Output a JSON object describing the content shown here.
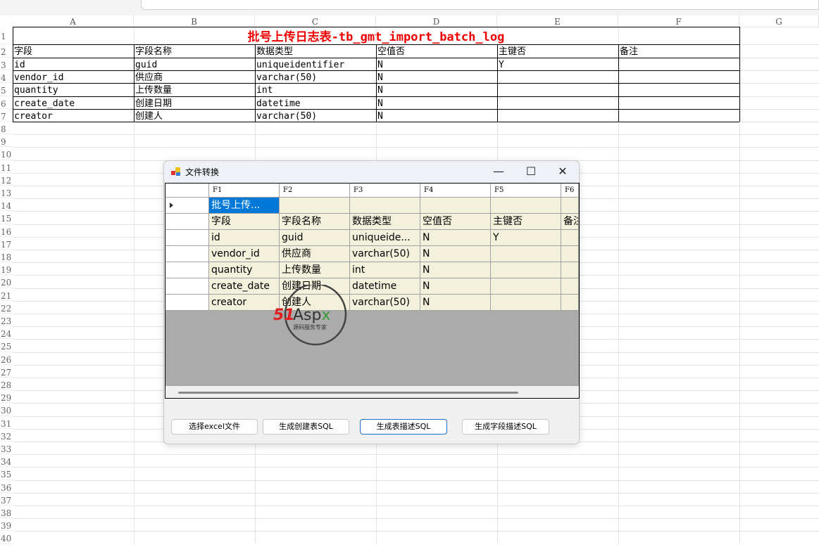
{
  "sheet": {
    "columns": [
      "A",
      "B",
      "C",
      "D",
      "E",
      "F",
      "G"
    ],
    "rows": [
      "1",
      "2",
      "3",
      "4",
      "5",
      "6",
      "7",
      "8",
      "9",
      "10",
      "11",
      "12",
      "13",
      "14",
      "15",
      "16",
      "17",
      "18",
      "19",
      "20",
      "21",
      "22",
      "23",
      "24",
      "25",
      "26",
      "27",
      "28",
      "29",
      "30",
      "31",
      "32",
      "33",
      "34",
      "35",
      "36",
      "37",
      "38",
      "39",
      "40"
    ],
    "title": "批号上传日志表-tb_gmt_import_batch_log",
    "header": [
      "字段",
      "字段名称",
      "数据类型",
      "空值否",
      "主键否",
      "备注"
    ],
    "data": [
      [
        "id",
        "guid",
        "uniqueidentifier",
        "N",
        "Y",
        ""
      ],
      [
        "vendor_id",
        "供应商",
        "varchar(50)",
        "N",
        "",
        ""
      ],
      [
        "quantity",
        "上传数量",
        "int",
        "N",
        "",
        ""
      ],
      [
        "create_date",
        "创建日期",
        "datetime",
        "N",
        "",
        ""
      ],
      [
        "creator",
        "创建人",
        "varchar(50)",
        "N",
        "",
        ""
      ]
    ]
  },
  "dialog": {
    "title": "文件转换",
    "minimize": "—",
    "maximize": "☐",
    "close": "✕",
    "grid_columns": [
      "F1",
      "F2",
      "F3",
      "F4",
      "F5",
      "F6"
    ],
    "grid_rows": [
      [
        "批号上传...",
        "",
        "",
        "",
        "",
        ""
      ],
      [
        "字段",
        "字段名称",
        "数据类型",
        "空值否",
        "主键否",
        "备注"
      ],
      [
        "id",
        "guid",
        "uniqueide...",
        "N",
        "Y",
        ""
      ],
      [
        "vendor_id",
        "供应商",
        "varchar(50)",
        "N",
        "",
        ""
      ],
      [
        "quantity",
        "上传数量",
        "int",
        "N",
        "",
        ""
      ],
      [
        "create_date",
        "创建日期",
        "datetime",
        "N",
        "",
        ""
      ],
      [
        "creator",
        "创建人",
        "varchar(50)",
        "N",
        "",
        ""
      ]
    ],
    "buttons": [
      "选择excel文件",
      "生成创建表SQL",
      "生成表描述SQL",
      "生成字段描述SQL"
    ]
  },
  "watermark": {
    "brand": "51Aspx",
    "tagline": "源码服务专家"
  },
  "colors": {
    "title_red": "#e00000",
    "selection": "#0078d7",
    "grid_cell": "#f3f1dc"
  }
}
